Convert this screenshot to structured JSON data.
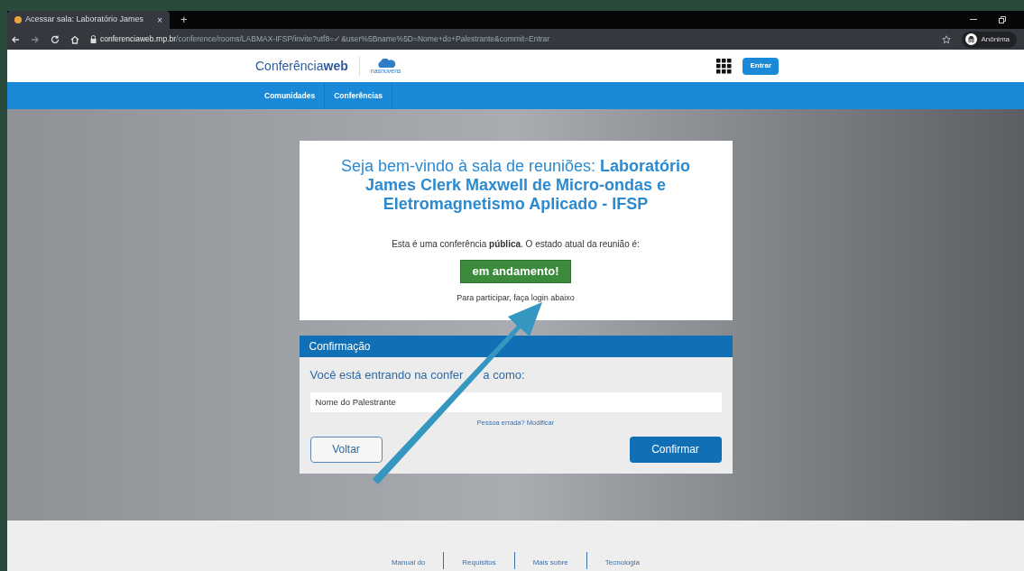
{
  "browser": {
    "tab_title": "Acessar sala: Laboratório James",
    "close": "×",
    "new_tab": "+",
    "url_host": "conferenciaweb.rnp.br",
    "url_path": "/conference/rooms/LABMAX-IFSP/invite?utf8=✓&user%5Bname%5D=Nome+do+Palestrante&commit=Entrar",
    "profile": "Anônima"
  },
  "header": {
    "logo_light": "Conferência",
    "logo_bold": "web",
    "partner": "nasnuvens",
    "login_button": "Entrar"
  },
  "nav": [
    {
      "label": "Comunidades"
    },
    {
      "label": "Conferências"
    }
  ],
  "welcome": {
    "title": "Seja bem-vindo à sala de reuniões: **Laboratório James Clerk Maxwell de Micro-ondas e Eletromagnetismo Aplicado - IFSP**",
    "status_text": "Esta é uma conferência **pública**. O estado atual da reunião é:",
    "status_badge": "em andamento!",
    "hint": "Para participar, faça login abaixo"
  },
  "confirmation": {
    "title": "Confirmação",
    "prompt_start": "Você está entrando na confer",
    "prompt_end": "a como:",
    "name_value": "Nome do Palestrante",
    "wrong_person": "Pessoa errada? Modificar",
    "back_button": "Voltar",
    "confirm_button": "Confirmar"
  },
  "footer": [
    {
      "label": "Manual do"
    },
    {
      "label": "Requisitos"
    },
    {
      "label": "Mais sobre"
    },
    {
      "label": "Tecnologia"
    }
  ]
}
